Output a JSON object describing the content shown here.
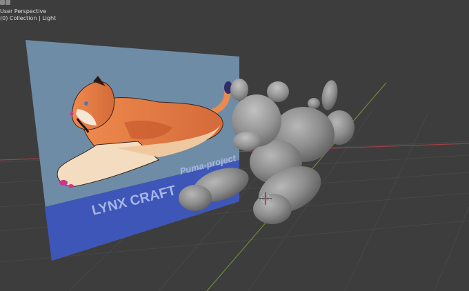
{
  "viewport": {
    "view_name": "User Perspective",
    "collection_info": "(0) Collection | Light",
    "bg_color": "#3d3d3d",
    "grid_color": "#474747",
    "axis_x_color": "#9c4148",
    "axis_y_color": "#6d8a3a"
  },
  "reference_image": {
    "brand_text": "LYNX CRAFT",
    "project_text": "Puma-project",
    "sky_color": "#6e8ca6",
    "band_color": "#3d56b8"
  },
  "model": {
    "color": "#8f8f8f",
    "object_name": "grey balloon-style puma mesh"
  }
}
